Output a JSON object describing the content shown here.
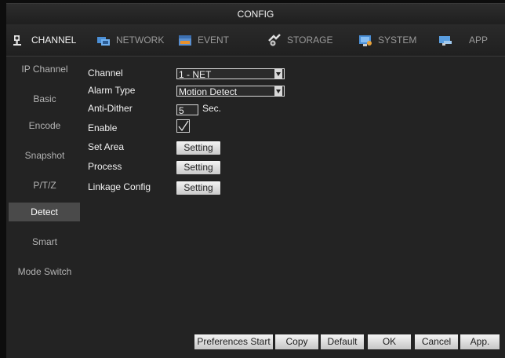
{
  "window": {
    "title": "CONFIG"
  },
  "tabs": [
    {
      "label": "CHANNEL",
      "icon": "channel-icon",
      "active": true
    },
    {
      "label": "NETWORK",
      "icon": "network-icon"
    },
    {
      "label": "EVENT",
      "icon": "event-icon"
    },
    {
      "label": "STORAGE",
      "icon": "storage-icon"
    },
    {
      "label": "SYSTEM",
      "icon": "system-icon"
    },
    {
      "label": "APP",
      "icon": "app-icon"
    }
  ],
  "sidebar": {
    "items": [
      {
        "label": "IP Channel"
      },
      {
        "label": "Basic"
      },
      {
        "label": "Encode"
      },
      {
        "label": "Snapshot"
      },
      {
        "label": "P/T/Z"
      },
      {
        "label": "Detect",
        "active": true
      },
      {
        "label": "Smart"
      },
      {
        "label": "Mode Switch"
      }
    ]
  },
  "form": {
    "channel": {
      "label": "Channel",
      "value": "1 - NET"
    },
    "alarm_type": {
      "label": "Alarm Type",
      "value": "Motion Detect"
    },
    "anti_dither": {
      "label": "Anti-Dither",
      "value": "5",
      "unit": "Sec."
    },
    "enable": {
      "label": "Enable",
      "checked": true
    },
    "set_area": {
      "label": "Set Area",
      "button": "Setting"
    },
    "process": {
      "label": "Process",
      "button": "Setting"
    },
    "linkage": {
      "label": "Linkage Config",
      "button": "Setting"
    }
  },
  "bottom": {
    "preferences_start": "Preferences Start",
    "copy": "Copy",
    "default": "Default",
    "ok": "OK",
    "cancel": "Cancel",
    "apply": "App."
  },
  "colors": {
    "background": "#232323",
    "active_item": "#4a4a4a",
    "button": "#d9d9d9",
    "text": "#f2f2f2"
  }
}
